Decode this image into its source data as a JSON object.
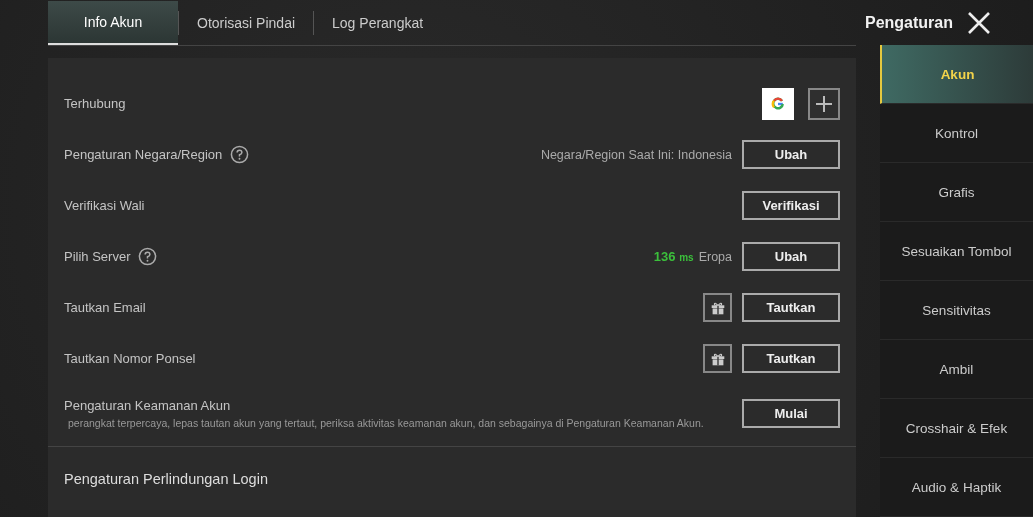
{
  "tabs": [
    {
      "label": "Info Akun",
      "selected": true
    },
    {
      "label": "Otorisasi Pindai",
      "selected": false
    },
    {
      "label": "Log Perangkat",
      "selected": false
    }
  ],
  "header": {
    "title": "Pengaturan"
  },
  "sidebar": {
    "items": [
      {
        "label": "Akun",
        "selected": true
      },
      {
        "label": "Kontrol",
        "selected": false
      },
      {
        "label": "Grafis",
        "selected": false
      },
      {
        "label": "Sesuaikan Tombol",
        "selected": false
      },
      {
        "label": "Sensitivitas",
        "selected": false
      },
      {
        "label": "Ambil",
        "selected": false
      },
      {
        "label": "Crosshair & Efek",
        "selected": false
      },
      {
        "label": "Audio & Haptik",
        "selected": false
      }
    ]
  },
  "rows": [
    {
      "kind": "linked",
      "label": "Terhubung",
      "help": false,
      "gift": false
    },
    {
      "kind": "action",
      "label": "Pengaturan Negara/Region",
      "help": true,
      "gift": false,
      "info": "Negara/Region Saat Ini: Indonesia",
      "button": "Ubah"
    },
    {
      "kind": "action",
      "label": "Verifikasi Wali",
      "help": false,
      "gift": false,
      "button": "Verifikasi"
    },
    {
      "kind": "action",
      "label": "Pilih Server",
      "help": true,
      "gift": false,
      "ping_value": "136",
      "ping_unit": "ms",
      "info": "Eropa",
      "button": "Ubah"
    },
    {
      "kind": "action",
      "label": "Tautkan Email",
      "help": false,
      "gift": true,
      "button": "Tautkan"
    },
    {
      "kind": "action",
      "label": "Tautkan Nomor Ponsel",
      "help": false,
      "gift": true,
      "button": "Tautkan"
    },
    {
      "kind": "described",
      "label": "Pengaturan Keamanan Akun",
      "help": false,
      "gift": false,
      "description": "perangkat terpercaya, lepas tautan akun yang tertaut, periksa aktivitas keamanan akun, dan sebagainya di Pengaturan Keamanan Akun.",
      "button": "Mulai"
    }
  ],
  "section": {
    "title": "Pengaturan Perlindungan Login"
  }
}
